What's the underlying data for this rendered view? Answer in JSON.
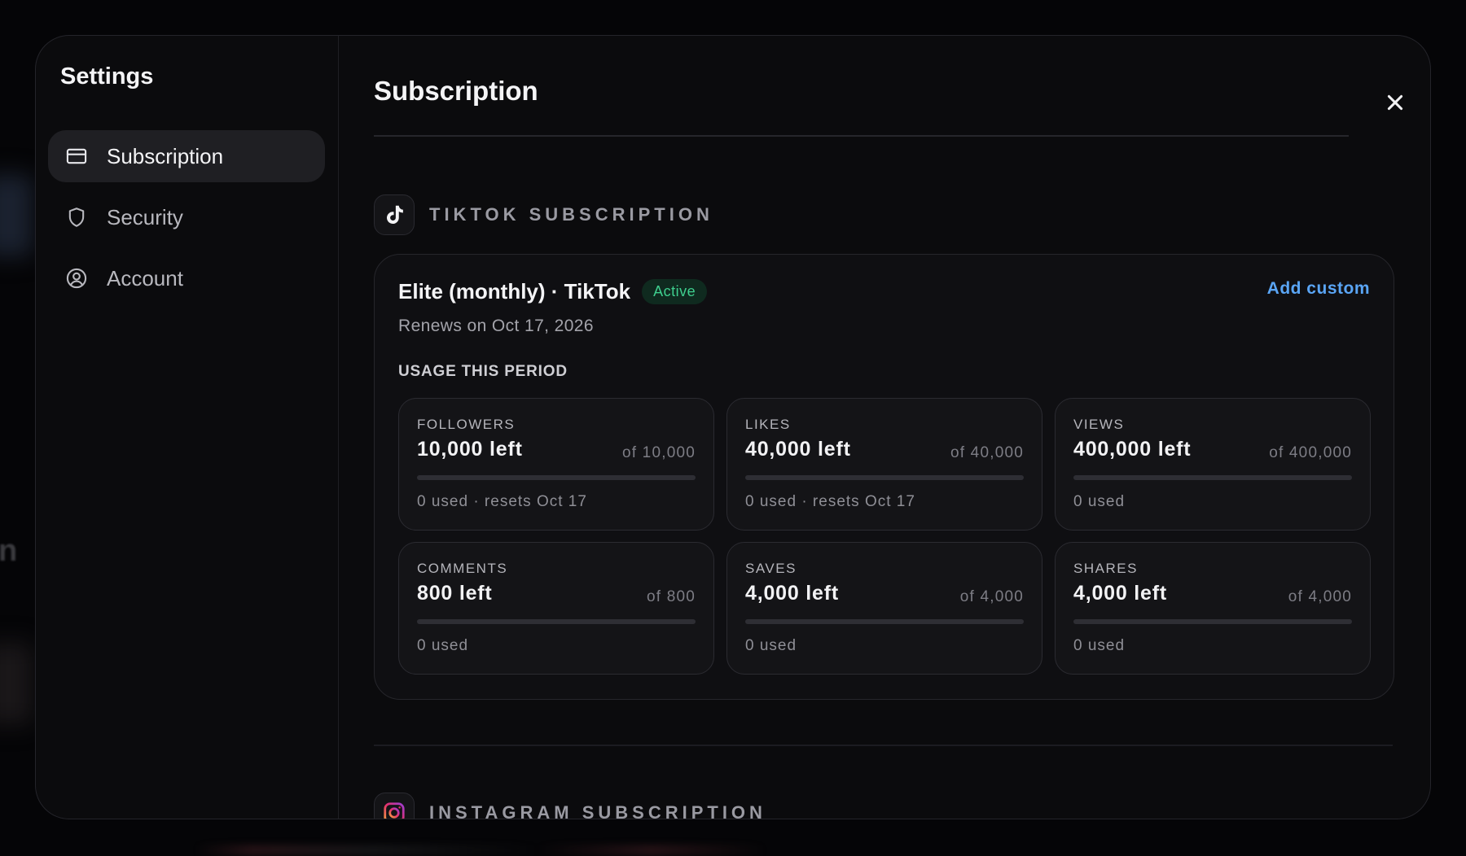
{
  "sidebar": {
    "title": "Settings",
    "items": [
      {
        "label": "Subscription",
        "icon": "credit-card-icon",
        "active": true
      },
      {
        "label": "Security",
        "icon": "shield-icon",
        "active": false
      },
      {
        "label": "Account",
        "icon": "user-circle-icon",
        "active": false
      }
    ]
  },
  "main": {
    "title": "Subscription",
    "close_icon": "close-icon"
  },
  "tiktok": {
    "section_label": "TIKTOK SUBSCRIPTION",
    "icon": "tiktok-icon",
    "plan_name": "Elite (monthly) · TikTok",
    "status": "Active",
    "renews": "Renews on Oct 17, 2026",
    "add_custom": "Add custom",
    "usage_label": "USAGE THIS PERIOD",
    "metrics": [
      {
        "label": "FOLLOWERS",
        "left": "10,000 left",
        "of": "of 10,000",
        "used": "0 used · resets Oct 17",
        "used_fraction": 0
      },
      {
        "label": "LIKES",
        "left": "40,000 left",
        "of": "of 40,000",
        "used": "0 used · resets Oct 17",
        "used_fraction": 0
      },
      {
        "label": "VIEWS",
        "left": "400,000 left",
        "of": "of 400,000",
        "used": "0 used",
        "used_fraction": 0
      },
      {
        "label": "COMMENTS",
        "left": "800 left",
        "of": "of 800",
        "used": "0 used",
        "used_fraction": 0
      },
      {
        "label": "SAVES",
        "left": "4,000 left",
        "of": "of 4,000",
        "used": "0 used",
        "used_fraction": 0
      },
      {
        "label": "SHARES",
        "left": "4,000 left",
        "of": "of 4,000",
        "used": "0 used",
        "used_fraction": 0
      }
    ]
  },
  "instagram": {
    "section_label": "INSTAGRAM SUBSCRIPTION",
    "icon": "instagram-icon"
  },
  "colors": {
    "accent": "#5aa5f5",
    "active_badge_text": "#3ecf8e",
    "active_badge_bg": "#0f2a1f"
  }
}
